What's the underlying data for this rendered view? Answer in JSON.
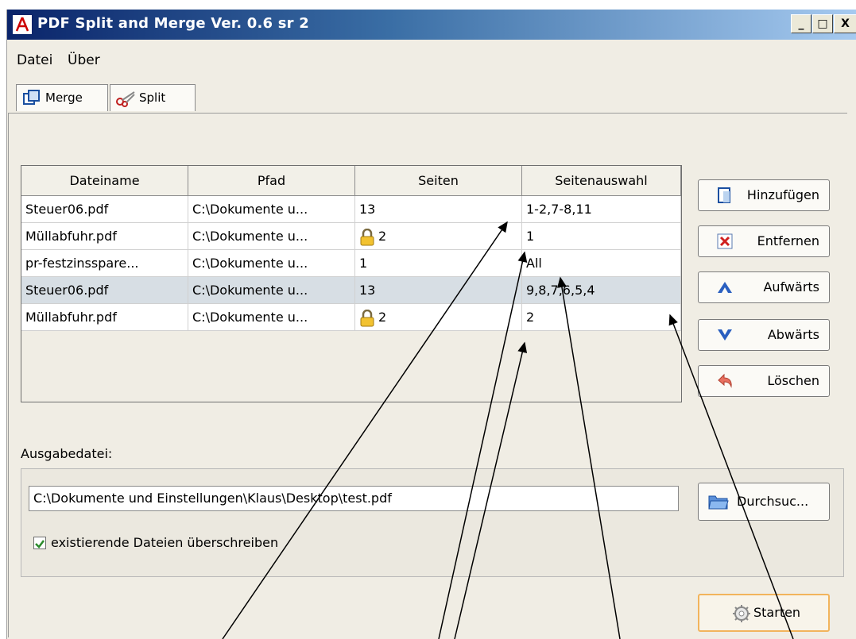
{
  "window": {
    "title": "PDF Split and Merge Ver. 0.6 sr 2",
    "min": "_",
    "max": "□",
    "close": "X"
  },
  "menu": {
    "items": [
      "Datei",
      "Über"
    ]
  },
  "tabs": [
    {
      "label": "Merge",
      "icon": "merge-icon"
    },
    {
      "label": "Split",
      "icon": "scissors-icon"
    }
  ],
  "table": {
    "headers": [
      "Dateiname",
      "Pfad",
      "Seiten",
      "Seitenauswahl"
    ],
    "rows": [
      {
        "name": "Steuer06.pdf",
        "path": "C:\\Dokumente u...",
        "pages": "13",
        "locked": false,
        "selection": "1-2,7-8,11"
      },
      {
        "name": "Müllabfuhr.pdf",
        "path": "C:\\Dokumente u...",
        "pages": "2",
        "locked": true,
        "selection": "1"
      },
      {
        "name": "pr-festzinsspare...",
        "path": "C:\\Dokumente u...",
        "pages": "1",
        "locked": false,
        "selection": "All"
      },
      {
        "name": "Steuer06.pdf",
        "path": "C:\\Dokumente u...",
        "pages": "13",
        "locked": false,
        "selection": "9,8,7,6,5,4"
      },
      {
        "name": "Müllabfuhr.pdf",
        "path": "C:\\Dokumente u...",
        "pages": "2",
        "locked": true,
        "selection": "2"
      }
    ]
  },
  "side_buttons": {
    "add": "Hinzufügen",
    "remove": "Entfernen",
    "up": "Aufwärts",
    "down": "Abwärts",
    "clear": "Löschen"
  },
  "output": {
    "label": "Ausgabedatei:",
    "value": "C:\\Dokumente und Einstellungen\\Klaus\\Desktop\\test.pdf",
    "browse_label": "Durchsuc...",
    "overwrite_label": "existierende Dateien überschreiben",
    "overwrite_checked": true
  },
  "start_label": "Starten",
  "colors": {
    "accent_orange": "#f2b45c",
    "selected_row": "#d7dee4",
    "title_blue": "#0a246a"
  }
}
